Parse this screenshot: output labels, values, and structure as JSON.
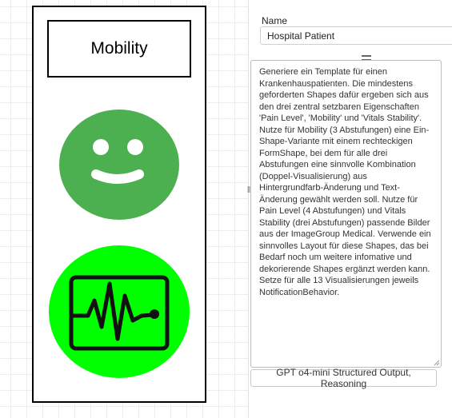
{
  "canvas": {
    "mobility_label": "Mobility",
    "pain_icon": "smiley-face-icon",
    "pain_color": "#4caf50",
    "vitals_icon": "heart-monitor-icon",
    "vitals_color": "#00ff00"
  },
  "properties": {
    "name_label": "Name",
    "name_value": "Hospital Patient",
    "prompt_text": "Generiere ein Template für einen Krankenhauspatienten. Die mindestens geforderten Shapes dafür ergeben sich aus den drei zentral setzbaren Eigenschaften 'Pain Level', 'Mobility' und 'Vitals Stability'. Nutze für Mobility (3 Abstufungen) eine Ein-Shape-Variante mit einem rechteckigen FormShape, bei dem für alle drei Abstufungen eine sinnvolle Kombination (Doppel-Visualisierung) aus Hintergrundfarb-Änderung und Text-Änderung gewählt werden soll. Nutze für Pain Level (4 Abstufungen) und Vitals Stability (drei Abstufungen) passende Bilder aus der ImageGroup Medical. Verwende ein sinnvolles Layout für diese Shapes, das bei Bedarf noch um weitere infomative und dekorierende Shapes ergänzt werden kann. Setze für alle 13 Visualisierungen jeweils NotificationBehavior.",
    "model_button_label": "GPT o4-mini Structured Output, Reasoning"
  }
}
